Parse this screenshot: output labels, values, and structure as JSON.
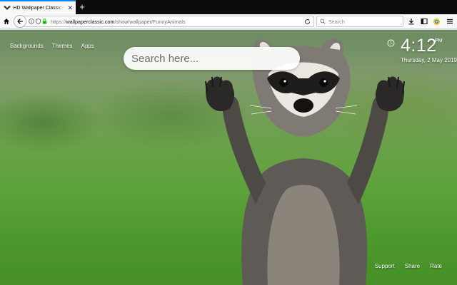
{
  "browser": {
    "tab_title": "HD Wallpaper Classic - Funn",
    "new_tab": "+",
    "url_prefix": "https://",
    "url_host": "wallpaperclassic.com",
    "url_path": "/show/wallpaper/FunnyAnimals",
    "search_placeholder": "Search",
    "accent_color": "#0a84ff"
  },
  "page": {
    "nav_links": [
      "Backgrounds",
      "Themes",
      "Apps"
    ],
    "search_placeholder": "Search here...",
    "clock": {
      "time": "4:12",
      "ampm": "PM",
      "date": "Thursday, 2 May 2019"
    },
    "footer_links": [
      "Support",
      "Share",
      "Rate"
    ],
    "wallpaper": "raccoon-standing-arms-up"
  }
}
